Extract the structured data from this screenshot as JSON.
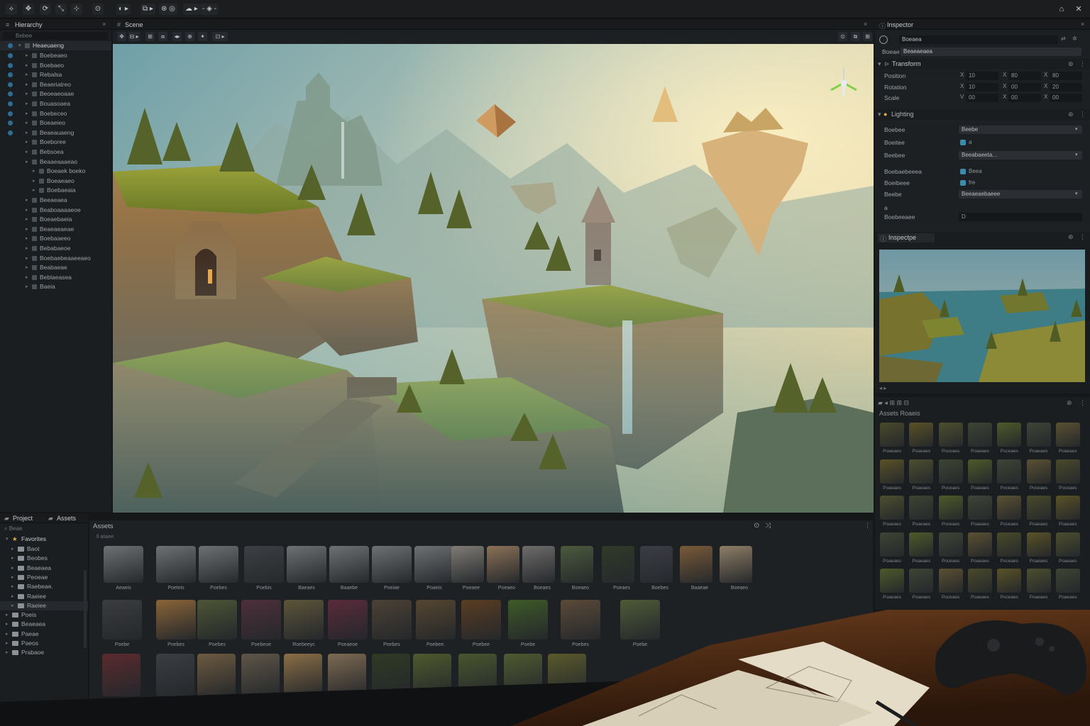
{
  "toolbar": {
    "left_buttons": [
      "⟡",
      "✥",
      "⟳",
      "⤡",
      "⊹",
      "⊙",
      "◐ ▸",
      "⧉ ▸",
      "⊛ ◎",
      "☁ ▸",
      "- ◈ -"
    ],
    "right_buttons": [
      "⌂",
      "✕"
    ]
  },
  "hierarchy": {
    "tab": "Hierarchy",
    "search_placeholder": "Bebee",
    "root": "Heaeuaeng",
    "items": [
      {
        "label": "Boebeaeo",
        "indent": 1
      },
      {
        "label": "Boebaeo",
        "indent": 1
      },
      {
        "label": "Rebalsa",
        "indent": 1
      },
      {
        "label": "Beaeriatreo",
        "indent": 1
      },
      {
        "label": "Beoeaeoaae",
        "indent": 1
      },
      {
        "label": "Bouasoaea",
        "indent": 1
      },
      {
        "label": "Boebeceo",
        "indent": 1
      },
      {
        "label": "Boeaeieo",
        "indent": 1
      },
      {
        "label": "Beaeauaeng",
        "indent": 1
      },
      {
        "label": "Boeboree",
        "indent": 1
      },
      {
        "label": "Bebsoea",
        "indent": 1
      },
      {
        "label": "Beaaeaaaeao",
        "indent": 1
      },
      {
        "label": "Boeaek boeko",
        "indent": 2
      },
      {
        "label": "Boeaeaeo",
        "indent": 2
      },
      {
        "label": "Boebaeaia",
        "indent": 2
      },
      {
        "label": "Beeaeaea",
        "indent": 1
      },
      {
        "label": "Beaboaaaaeoe",
        "indent": 1
      },
      {
        "label": "Boeaebaeia",
        "indent": 1
      },
      {
        "label": "Beaeaeaeae",
        "indent": 1
      },
      {
        "label": "Boebaaeeo",
        "indent": 1
      },
      {
        "label": "Bebabaeoe",
        "indent": 1
      },
      {
        "label": "Boebaebeaaeeaeo",
        "indent": 1
      },
      {
        "label": "Beabaeae",
        "indent": 1
      },
      {
        "label": "Beblaeasea",
        "indent": 1
      },
      {
        "label": "Baeia",
        "indent": 1
      }
    ]
  },
  "scene": {
    "tab": "Scene",
    "tools": [
      "✥",
      "⊟ ▸",
      "⊞",
      "⧈",
      "◂▸",
      "⊕",
      "✦",
      "⊡ ▸"
    ],
    "right_tools": [
      "⊙",
      "⧉",
      "⊞"
    ]
  },
  "inspector": {
    "tab": "Inspector",
    "object_name": "Boeaea",
    "field_label": "Boeae",
    "field_value": "Beaeaeaea",
    "transform": {
      "title": "Transform",
      "position": {
        "label": "Position",
        "x_axis": "X",
        "x": "10",
        "y_axis": "X",
        "y": "80",
        "z_axis": "X",
        "z": "80"
      },
      "rotation": {
        "label": "Rotation",
        "x_axis": "X",
        "x": "10",
        "y_axis": "X",
        "y": "00",
        "z_axis": "X",
        "z": "20"
      },
      "scale": {
        "label": "Scale",
        "x_axis": "V",
        "x": "00",
        "y_axis": "X",
        "y": "00",
        "z_axis": "X",
        "z": "00"
      }
    },
    "lighting": {
      "title": "Lighting",
      "rows": [
        {
          "label": "Boebee",
          "value": "Beebe",
          "kind": "dropdown"
        },
        {
          "label": "Boeitee",
          "value": "a",
          "kind": "check"
        },
        {
          "label": "Beebee",
          "value": "Beeabaeeta…",
          "kind": "dropdown"
        },
        {
          "label": "Boebaebeeea",
          "value": "Beea",
          "kind": "check"
        },
        {
          "label": "Boeibeee",
          "value": "fre",
          "kind": "check"
        },
        {
          "label": "Beebe",
          "value": "Beeaeaebaeee",
          "kind": "dropdown"
        },
        {
          "label": "a",
          "value": "",
          "kind": "blank"
        },
        {
          "label": "Boebeeaee",
          "value": "D",
          "kind": "box"
        }
      ]
    },
    "preview_tab": "Inspectpe"
  },
  "assets_right": {
    "path": "Assets   Roaeis",
    "labels": [
      [
        "Poaeaes",
        "Poaeaes",
        "Poceaes",
        "Poaeaes",
        "Poceaes",
        "Poaeaes",
        "Poaeaes"
      ],
      [
        "Poaeaes",
        "Poaeaes",
        "Poceaes",
        "Poaeaes",
        "Poceaes",
        "Poceaes",
        "Poceaes"
      ],
      [
        "Poaeaes",
        "Poaeaes",
        "Poceaes",
        "Poaeaes",
        "Poceaes",
        "Poaeaes",
        "Poaeaes"
      ],
      [
        "Poaeaes",
        "Poaeaes",
        "Poceaes",
        "Poaeaes",
        "Poceaes",
        "Poaeaes",
        "Poaeaes"
      ],
      [
        "Poaeaes",
        "Poaeaes",
        "Poceaes",
        "Poaeaes",
        "Poceaes",
        "Poaeaes",
        "Poaeaes"
      ]
    ]
  },
  "project": {
    "tab_project": "Project",
    "tab_assets": "Assets",
    "search_placeholder": "Beae",
    "favorites": "Favorites",
    "folders": [
      {
        "label": "Baot",
        "indent": 2
      },
      {
        "label": "Beobes",
        "indent": 2
      },
      {
        "label": "Beaeaea",
        "indent": 2
      },
      {
        "label": "Peoeae",
        "indent": 2
      },
      {
        "label": "Raebeae.",
        "indent": 2
      },
      {
        "label": "Raeiee",
        "indent": 2
      },
      {
        "label": "Raeiee",
        "indent": 2,
        "selected": true
      },
      {
        "label": "Poeis",
        "indent": 1
      },
      {
        "label": "Beaeaea",
        "indent": 1
      },
      {
        "label": "Paeae",
        "indent": 1
      },
      {
        "label": "Paeos",
        "indent": 1
      },
      {
        "label": "Prabaoe",
        "indent": 1
      }
    ]
  },
  "assets_main": {
    "title": "Assets",
    "breadcrumb": "ll ataee.",
    "row1": [
      "Aeaeis",
      "Poeteis",
      "Poebes",
      "Poebis",
      "Baeaes",
      "Baaebe",
      "Poeiae",
      "Poaeis",
      "Poeaee",
      "Poeaeo",
      "Boeaes",
      "Boeaeo",
      "Poeaes",
      "Boebes",
      "Baaeae",
      "Boeaeo"
    ],
    "row2": [
      "Poebe",
      "Poebes",
      "Poebes",
      "Poebeoe",
      "Roebeeyc",
      "Poeaeoe",
      "Poebes",
      "Poebee.",
      "Poebee",
      "Poebe",
      "Poebes",
      "Poebe"
    ]
  },
  "colors": {
    "accent_blue": "#2d6c94",
    "panel_bg": "#1e2124",
    "favorites_star": "#e0b23c"
  }
}
